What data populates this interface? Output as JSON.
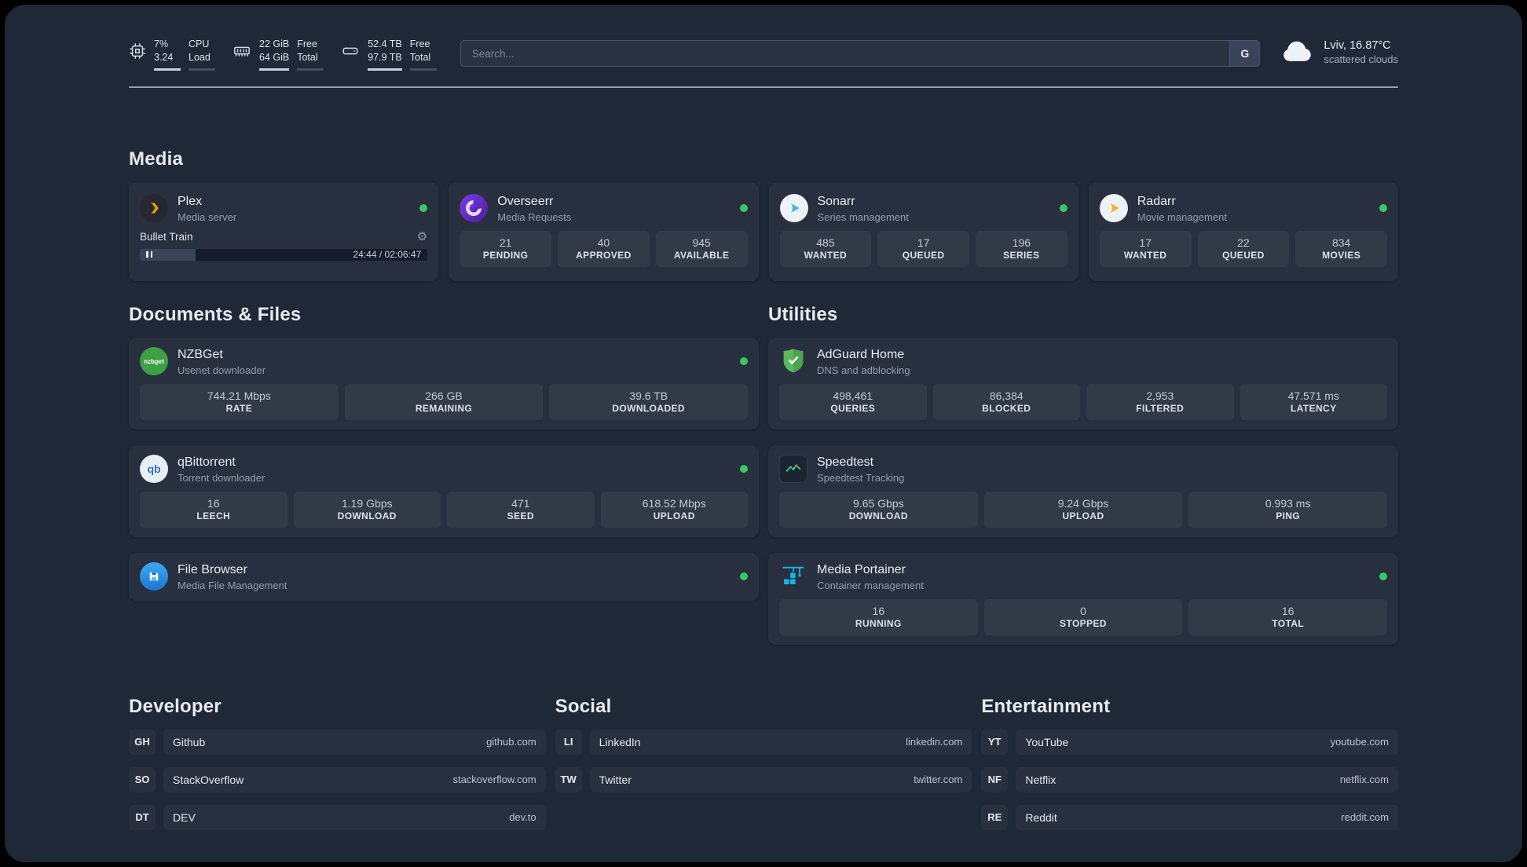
{
  "theme": {
    "status_online": "#3bc763",
    "plex_accent": "#e5a00d"
  },
  "topbar": {
    "cpu": {
      "v1": "7%",
      "v2": "3.24",
      "l1": "CPU",
      "l2": "Load"
    },
    "ram": {
      "v1": "22 GiB",
      "v2": "64 GiB",
      "l1": "Free",
      "l2": "Total"
    },
    "disk": {
      "v1": "52.4 TB",
      "v2": "97.9 TB",
      "l1": "Free",
      "l2": "Total"
    },
    "search": {
      "placeholder": "Search...",
      "engine": "G"
    },
    "weather": {
      "location": "Lviv, 16.87°C",
      "condition": "scattered clouds"
    }
  },
  "media": {
    "title": "Media",
    "plex": {
      "name": "Plex",
      "subtitle": "Media server",
      "track": "Bullet Train",
      "time": "24:44 / 02:06:47",
      "progress_pct": 19.5
    },
    "overseerr": {
      "name": "Overseerr",
      "subtitle": "Media Requests",
      "stats": [
        {
          "value": "21",
          "label": "PENDING"
        },
        {
          "value": "40",
          "label": "APPROVED"
        },
        {
          "value": "945",
          "label": "AVAILABLE"
        }
      ]
    },
    "sonarr": {
      "name": "Sonarr",
      "subtitle": "Series management",
      "stats": [
        {
          "value": "485",
          "label": "WANTED"
        },
        {
          "value": "17",
          "label": "QUEUED"
        },
        {
          "value": "196",
          "label": "SERIES"
        }
      ]
    },
    "radarr": {
      "name": "Radarr",
      "subtitle": "Movie management",
      "stats": [
        {
          "value": "17",
          "label": "WANTED"
        },
        {
          "value": "22",
          "label": "QUEUED"
        },
        {
          "value": "834",
          "label": "MOVIES"
        }
      ]
    }
  },
  "documents": {
    "title": "Documents & Files",
    "nzbget": {
      "name": "NZBGet",
      "subtitle": "Usenet downloader",
      "icon_text": "nzbget",
      "stats": [
        {
          "value": "744.21 Mbps",
          "label": "RATE"
        },
        {
          "value": "266 GB",
          "label": "REMAINING"
        },
        {
          "value": "39.6 TB",
          "label": "DOWNLOADED"
        }
      ]
    },
    "qbittorrent": {
      "name": "qBittorrent",
      "subtitle": "Torrent downloader",
      "icon_text": "qb",
      "stats": [
        {
          "value": "16",
          "label": "LEECH"
        },
        {
          "value": "1.19 Gbps",
          "label": "DOWNLOAD"
        },
        {
          "value": "471",
          "label": "SEED"
        },
        {
          "value": "618.52 Mbps",
          "label": "UPLOAD"
        }
      ]
    },
    "filebrowser": {
      "name": "File Browser",
      "subtitle": "Media File Management"
    }
  },
  "utilities": {
    "title": "Utilities",
    "adguard": {
      "name": "AdGuard Home",
      "subtitle": "DNS and adblocking",
      "stats": [
        {
          "value": "498,461",
          "label": "QUERIES"
        },
        {
          "value": "86,384",
          "label": "BLOCKED"
        },
        {
          "value": "2,953",
          "label": "FILTERED"
        },
        {
          "value": "47.571 ms",
          "label": "LATENCY"
        }
      ]
    },
    "speedtest": {
      "name": "Speedtest",
      "subtitle": "Speedtest Tracking",
      "stats": [
        {
          "value": "9.65 Gbps",
          "label": "DOWNLOAD"
        },
        {
          "value": "9.24 Gbps",
          "label": "UPLOAD"
        },
        {
          "value": "0.993 ms",
          "label": "PING"
        }
      ]
    },
    "portainer": {
      "name": "Media Portainer",
      "subtitle": "Container management",
      "stats": [
        {
          "value": "16",
          "label": "RUNNING"
        },
        {
          "value": "0",
          "label": "STOPPED"
        },
        {
          "value": "16",
          "label": "TOTAL"
        }
      ]
    }
  },
  "links": {
    "developer": {
      "title": "Developer",
      "items": [
        {
          "abbr": "GH",
          "name": "Github",
          "url": "github.com"
        },
        {
          "abbr": "SO",
          "name": "StackOverflow",
          "url": "stackoverflow.com"
        },
        {
          "abbr": "DT",
          "name": "DEV",
          "url": "dev.to"
        }
      ]
    },
    "social": {
      "title": "Social",
      "items": [
        {
          "abbr": "LI",
          "name": "LinkedIn",
          "url": "linkedin.com"
        },
        {
          "abbr": "TW",
          "name": "Twitter",
          "url": "twitter.com"
        }
      ]
    },
    "entertainment": {
      "title": "Entertainment",
      "items": [
        {
          "abbr": "YT",
          "name": "YouTube",
          "url": "youtube.com"
        },
        {
          "abbr": "NF",
          "name": "Netflix",
          "url": "netflix.com"
        },
        {
          "abbr": "RE",
          "name": "Reddit",
          "url": "reddit.com"
        }
      ]
    }
  }
}
